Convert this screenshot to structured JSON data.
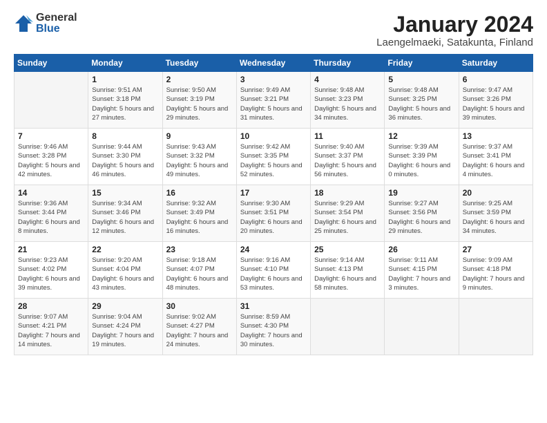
{
  "logo": {
    "general": "General",
    "blue": "Blue"
  },
  "title": "January 2024",
  "location": "Laengelmaeki, Satakunta, Finland",
  "weekdays": [
    "Sunday",
    "Monday",
    "Tuesday",
    "Wednesday",
    "Thursday",
    "Friday",
    "Saturday"
  ],
  "weeks": [
    [
      {
        "day": "",
        "sunrise": "",
        "sunset": "",
        "daylight": ""
      },
      {
        "day": "1",
        "sunrise": "Sunrise: 9:51 AM",
        "sunset": "Sunset: 3:18 PM",
        "daylight": "Daylight: 5 hours and 27 minutes."
      },
      {
        "day": "2",
        "sunrise": "Sunrise: 9:50 AM",
        "sunset": "Sunset: 3:19 PM",
        "daylight": "Daylight: 5 hours and 29 minutes."
      },
      {
        "day": "3",
        "sunrise": "Sunrise: 9:49 AM",
        "sunset": "Sunset: 3:21 PM",
        "daylight": "Daylight: 5 hours and 31 minutes."
      },
      {
        "day": "4",
        "sunrise": "Sunrise: 9:48 AM",
        "sunset": "Sunset: 3:23 PM",
        "daylight": "Daylight: 5 hours and 34 minutes."
      },
      {
        "day": "5",
        "sunrise": "Sunrise: 9:48 AM",
        "sunset": "Sunset: 3:25 PM",
        "daylight": "Daylight: 5 hours and 36 minutes."
      },
      {
        "day": "6",
        "sunrise": "Sunrise: 9:47 AM",
        "sunset": "Sunset: 3:26 PM",
        "daylight": "Daylight: 5 hours and 39 minutes."
      }
    ],
    [
      {
        "day": "7",
        "sunrise": "Sunrise: 9:46 AM",
        "sunset": "Sunset: 3:28 PM",
        "daylight": "Daylight: 5 hours and 42 minutes."
      },
      {
        "day": "8",
        "sunrise": "Sunrise: 9:44 AM",
        "sunset": "Sunset: 3:30 PM",
        "daylight": "Daylight: 5 hours and 46 minutes."
      },
      {
        "day": "9",
        "sunrise": "Sunrise: 9:43 AM",
        "sunset": "Sunset: 3:32 PM",
        "daylight": "Daylight: 5 hours and 49 minutes."
      },
      {
        "day": "10",
        "sunrise": "Sunrise: 9:42 AM",
        "sunset": "Sunset: 3:35 PM",
        "daylight": "Daylight: 5 hours and 52 minutes."
      },
      {
        "day": "11",
        "sunrise": "Sunrise: 9:40 AM",
        "sunset": "Sunset: 3:37 PM",
        "daylight": "Daylight: 5 hours and 56 minutes."
      },
      {
        "day": "12",
        "sunrise": "Sunrise: 9:39 AM",
        "sunset": "Sunset: 3:39 PM",
        "daylight": "Daylight: 6 hours and 0 minutes."
      },
      {
        "day": "13",
        "sunrise": "Sunrise: 9:37 AM",
        "sunset": "Sunset: 3:41 PM",
        "daylight": "Daylight: 6 hours and 4 minutes."
      }
    ],
    [
      {
        "day": "14",
        "sunrise": "Sunrise: 9:36 AM",
        "sunset": "Sunset: 3:44 PM",
        "daylight": "Daylight: 6 hours and 8 minutes."
      },
      {
        "day": "15",
        "sunrise": "Sunrise: 9:34 AM",
        "sunset": "Sunset: 3:46 PM",
        "daylight": "Daylight: 6 hours and 12 minutes."
      },
      {
        "day": "16",
        "sunrise": "Sunrise: 9:32 AM",
        "sunset": "Sunset: 3:49 PM",
        "daylight": "Daylight: 6 hours and 16 minutes."
      },
      {
        "day": "17",
        "sunrise": "Sunrise: 9:30 AM",
        "sunset": "Sunset: 3:51 PM",
        "daylight": "Daylight: 6 hours and 20 minutes."
      },
      {
        "day": "18",
        "sunrise": "Sunrise: 9:29 AM",
        "sunset": "Sunset: 3:54 PM",
        "daylight": "Daylight: 6 hours and 25 minutes."
      },
      {
        "day": "19",
        "sunrise": "Sunrise: 9:27 AM",
        "sunset": "Sunset: 3:56 PM",
        "daylight": "Daylight: 6 hours and 29 minutes."
      },
      {
        "day": "20",
        "sunrise": "Sunrise: 9:25 AM",
        "sunset": "Sunset: 3:59 PM",
        "daylight": "Daylight: 6 hours and 34 minutes."
      }
    ],
    [
      {
        "day": "21",
        "sunrise": "Sunrise: 9:23 AM",
        "sunset": "Sunset: 4:02 PM",
        "daylight": "Daylight: 6 hours and 39 minutes."
      },
      {
        "day": "22",
        "sunrise": "Sunrise: 9:20 AM",
        "sunset": "Sunset: 4:04 PM",
        "daylight": "Daylight: 6 hours and 43 minutes."
      },
      {
        "day": "23",
        "sunrise": "Sunrise: 9:18 AM",
        "sunset": "Sunset: 4:07 PM",
        "daylight": "Daylight: 6 hours and 48 minutes."
      },
      {
        "day": "24",
        "sunrise": "Sunrise: 9:16 AM",
        "sunset": "Sunset: 4:10 PM",
        "daylight": "Daylight: 6 hours and 53 minutes."
      },
      {
        "day": "25",
        "sunrise": "Sunrise: 9:14 AM",
        "sunset": "Sunset: 4:13 PM",
        "daylight": "Daylight: 6 hours and 58 minutes."
      },
      {
        "day": "26",
        "sunrise": "Sunrise: 9:11 AM",
        "sunset": "Sunset: 4:15 PM",
        "daylight": "Daylight: 7 hours and 3 minutes."
      },
      {
        "day": "27",
        "sunrise": "Sunrise: 9:09 AM",
        "sunset": "Sunset: 4:18 PM",
        "daylight": "Daylight: 7 hours and 9 minutes."
      }
    ],
    [
      {
        "day": "28",
        "sunrise": "Sunrise: 9:07 AM",
        "sunset": "Sunset: 4:21 PM",
        "daylight": "Daylight: 7 hours and 14 minutes."
      },
      {
        "day": "29",
        "sunrise": "Sunrise: 9:04 AM",
        "sunset": "Sunset: 4:24 PM",
        "daylight": "Daylight: 7 hours and 19 minutes."
      },
      {
        "day": "30",
        "sunrise": "Sunrise: 9:02 AM",
        "sunset": "Sunset: 4:27 PM",
        "daylight": "Daylight: 7 hours and 24 minutes."
      },
      {
        "day": "31",
        "sunrise": "Sunrise: 8:59 AM",
        "sunset": "Sunset: 4:30 PM",
        "daylight": "Daylight: 7 hours and 30 minutes."
      },
      {
        "day": "",
        "sunrise": "",
        "sunset": "",
        "daylight": ""
      },
      {
        "day": "",
        "sunrise": "",
        "sunset": "",
        "daylight": ""
      },
      {
        "day": "",
        "sunrise": "",
        "sunset": "",
        "daylight": ""
      }
    ]
  ]
}
